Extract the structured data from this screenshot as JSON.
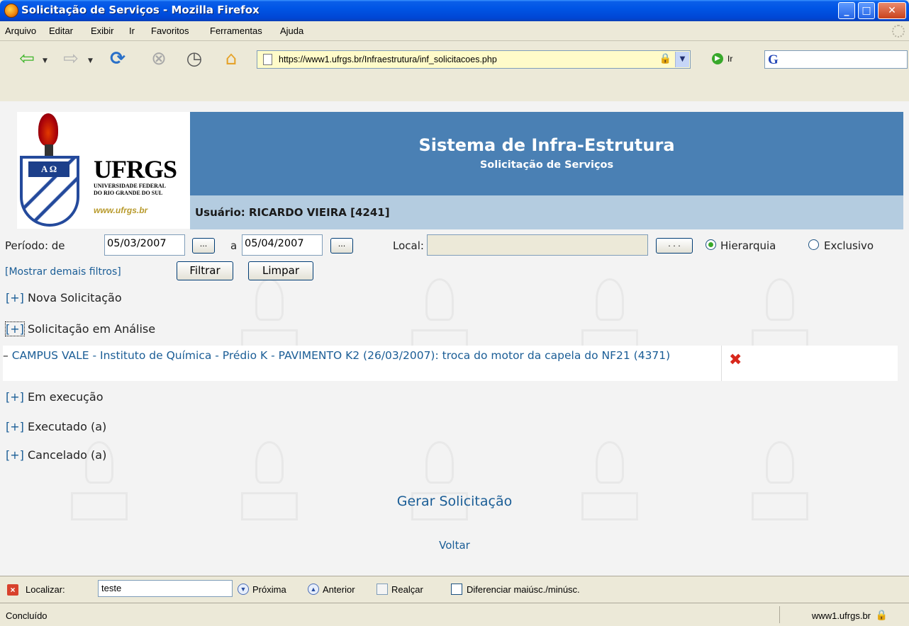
{
  "window": {
    "title": "Solicitação de Serviços - Mozilla Firefox"
  },
  "menu": [
    "Arquivo",
    "Editar",
    "Exibir",
    "Ir",
    "Favoritos",
    "Ferramentas",
    "Ajuda"
  ],
  "toolbar": {
    "url": "https://www1.ufrgs.br/Infraestrutura/inf_solicitacoes.php",
    "go_label": "Ir",
    "search_placeholder": ""
  },
  "header": {
    "logo_name": "UFRGS",
    "logo_sub_1": "UNIVERSIDADE FEDERAL",
    "logo_sub_2": "DO RIO GRANDE DO SUL",
    "logo_url": "www.ufrgs.br",
    "system_title": "Sistema de Infra-Estrutura",
    "system_subtitle": "Solicitação de Serviços",
    "user": "Usuário: RICARDO VIEIRA [4241]"
  },
  "filters": {
    "period_label": "Período: de",
    "date_from": "05/03/2007",
    "between_label": "a",
    "date_to": "05/04/2007",
    "picker_label": "...",
    "local_label": "Local:",
    "local_value": "",
    "local_picker_label": ". . .",
    "radio_hierarquia": "Hierarquia",
    "radio_exclusivo": "Exclusivo",
    "selected_radio": "Hierarquia",
    "more_filters": "[Mostrar demais filtros]",
    "filter_button": "Filtrar",
    "clear_button": "Limpar"
  },
  "sections": [
    {
      "toggle": "[+]",
      "label": "Nova Solicitação"
    },
    {
      "toggle": "[+]",
      "label": "Solicitação em Análise"
    },
    {
      "toggle": "[+]",
      "label": "Em execução"
    },
    {
      "toggle": "[+]",
      "label": "Executado (a)"
    },
    {
      "toggle": "[+]",
      "label": "Cancelado (a)"
    }
  ],
  "request": {
    "dash": "–",
    "text": "CAMPUS VALE - Instituto de Química - Prédio K - PAVIMENTO K2 (26/03/2007): troca do motor da capela do NF21 (4371)"
  },
  "actions": {
    "generate": "Gerar Solicitação",
    "back": "Voltar"
  },
  "findbar": {
    "label": "Localizar:",
    "value": "teste",
    "next": "Próxima",
    "previous": "Anterior",
    "highlight": "Realçar",
    "match_case": "Diferenciar maiúsc./minúsc."
  },
  "status": {
    "text": "Concluído",
    "host": "www1.ufrgs.br"
  },
  "colors": {
    "banner": "#4a80b4",
    "userbar": "#b4cce0",
    "link": "#1a5d96",
    "delete": "#d8271c"
  }
}
